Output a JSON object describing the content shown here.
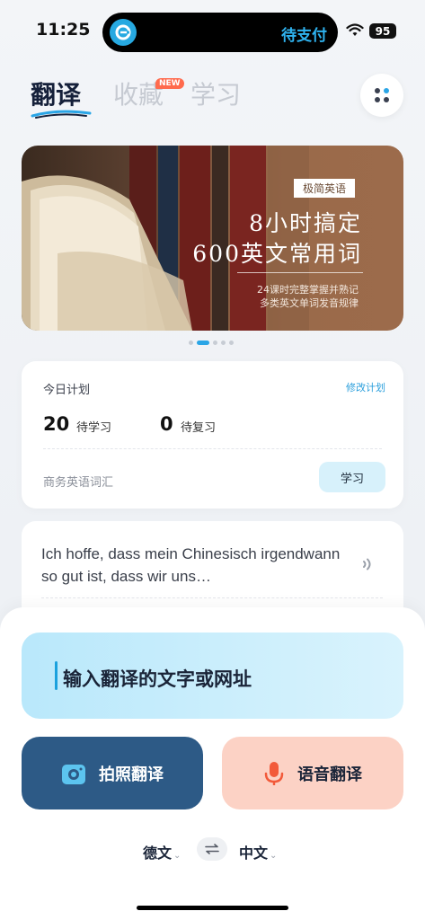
{
  "status_bar": {
    "time": "11:25",
    "island_text": "待支付",
    "battery": "95"
  },
  "header": {
    "tabs": [
      {
        "label": "翻译",
        "active": true
      },
      {
        "label": "收藏",
        "active": false
      },
      {
        "label": "学习",
        "active": false
      }
    ],
    "new_badge": "NEW",
    "accent_color": "#2aa5e6"
  },
  "banner": {
    "tag": "极简英语",
    "title_line1": "8小时搞定",
    "title_line2": "600英文常用词",
    "sub_line1": "24课时完整掌握并熟记",
    "sub_line2": "多类英文单词发音规律",
    "page_count": 5,
    "active_index": 1
  },
  "plan": {
    "title": "今日计划",
    "edit_label": "修改计划",
    "to_study_count": "20",
    "to_study_label": "待学习",
    "to_review_count": "0",
    "to_review_label": "待复习",
    "book_name": "商务英语词汇",
    "study_button": "学习"
  },
  "sentence": {
    "text": "Ich hoffe, dass mein Chinesisch irgendwann so gut ist, dass wir uns…"
  },
  "translate": {
    "input_placeholder": "输入翻译的文字或网址",
    "photo_button": "拍照翻译",
    "voice_button": "语音翻译",
    "source_lang": "德文",
    "target_lang": "中文"
  }
}
